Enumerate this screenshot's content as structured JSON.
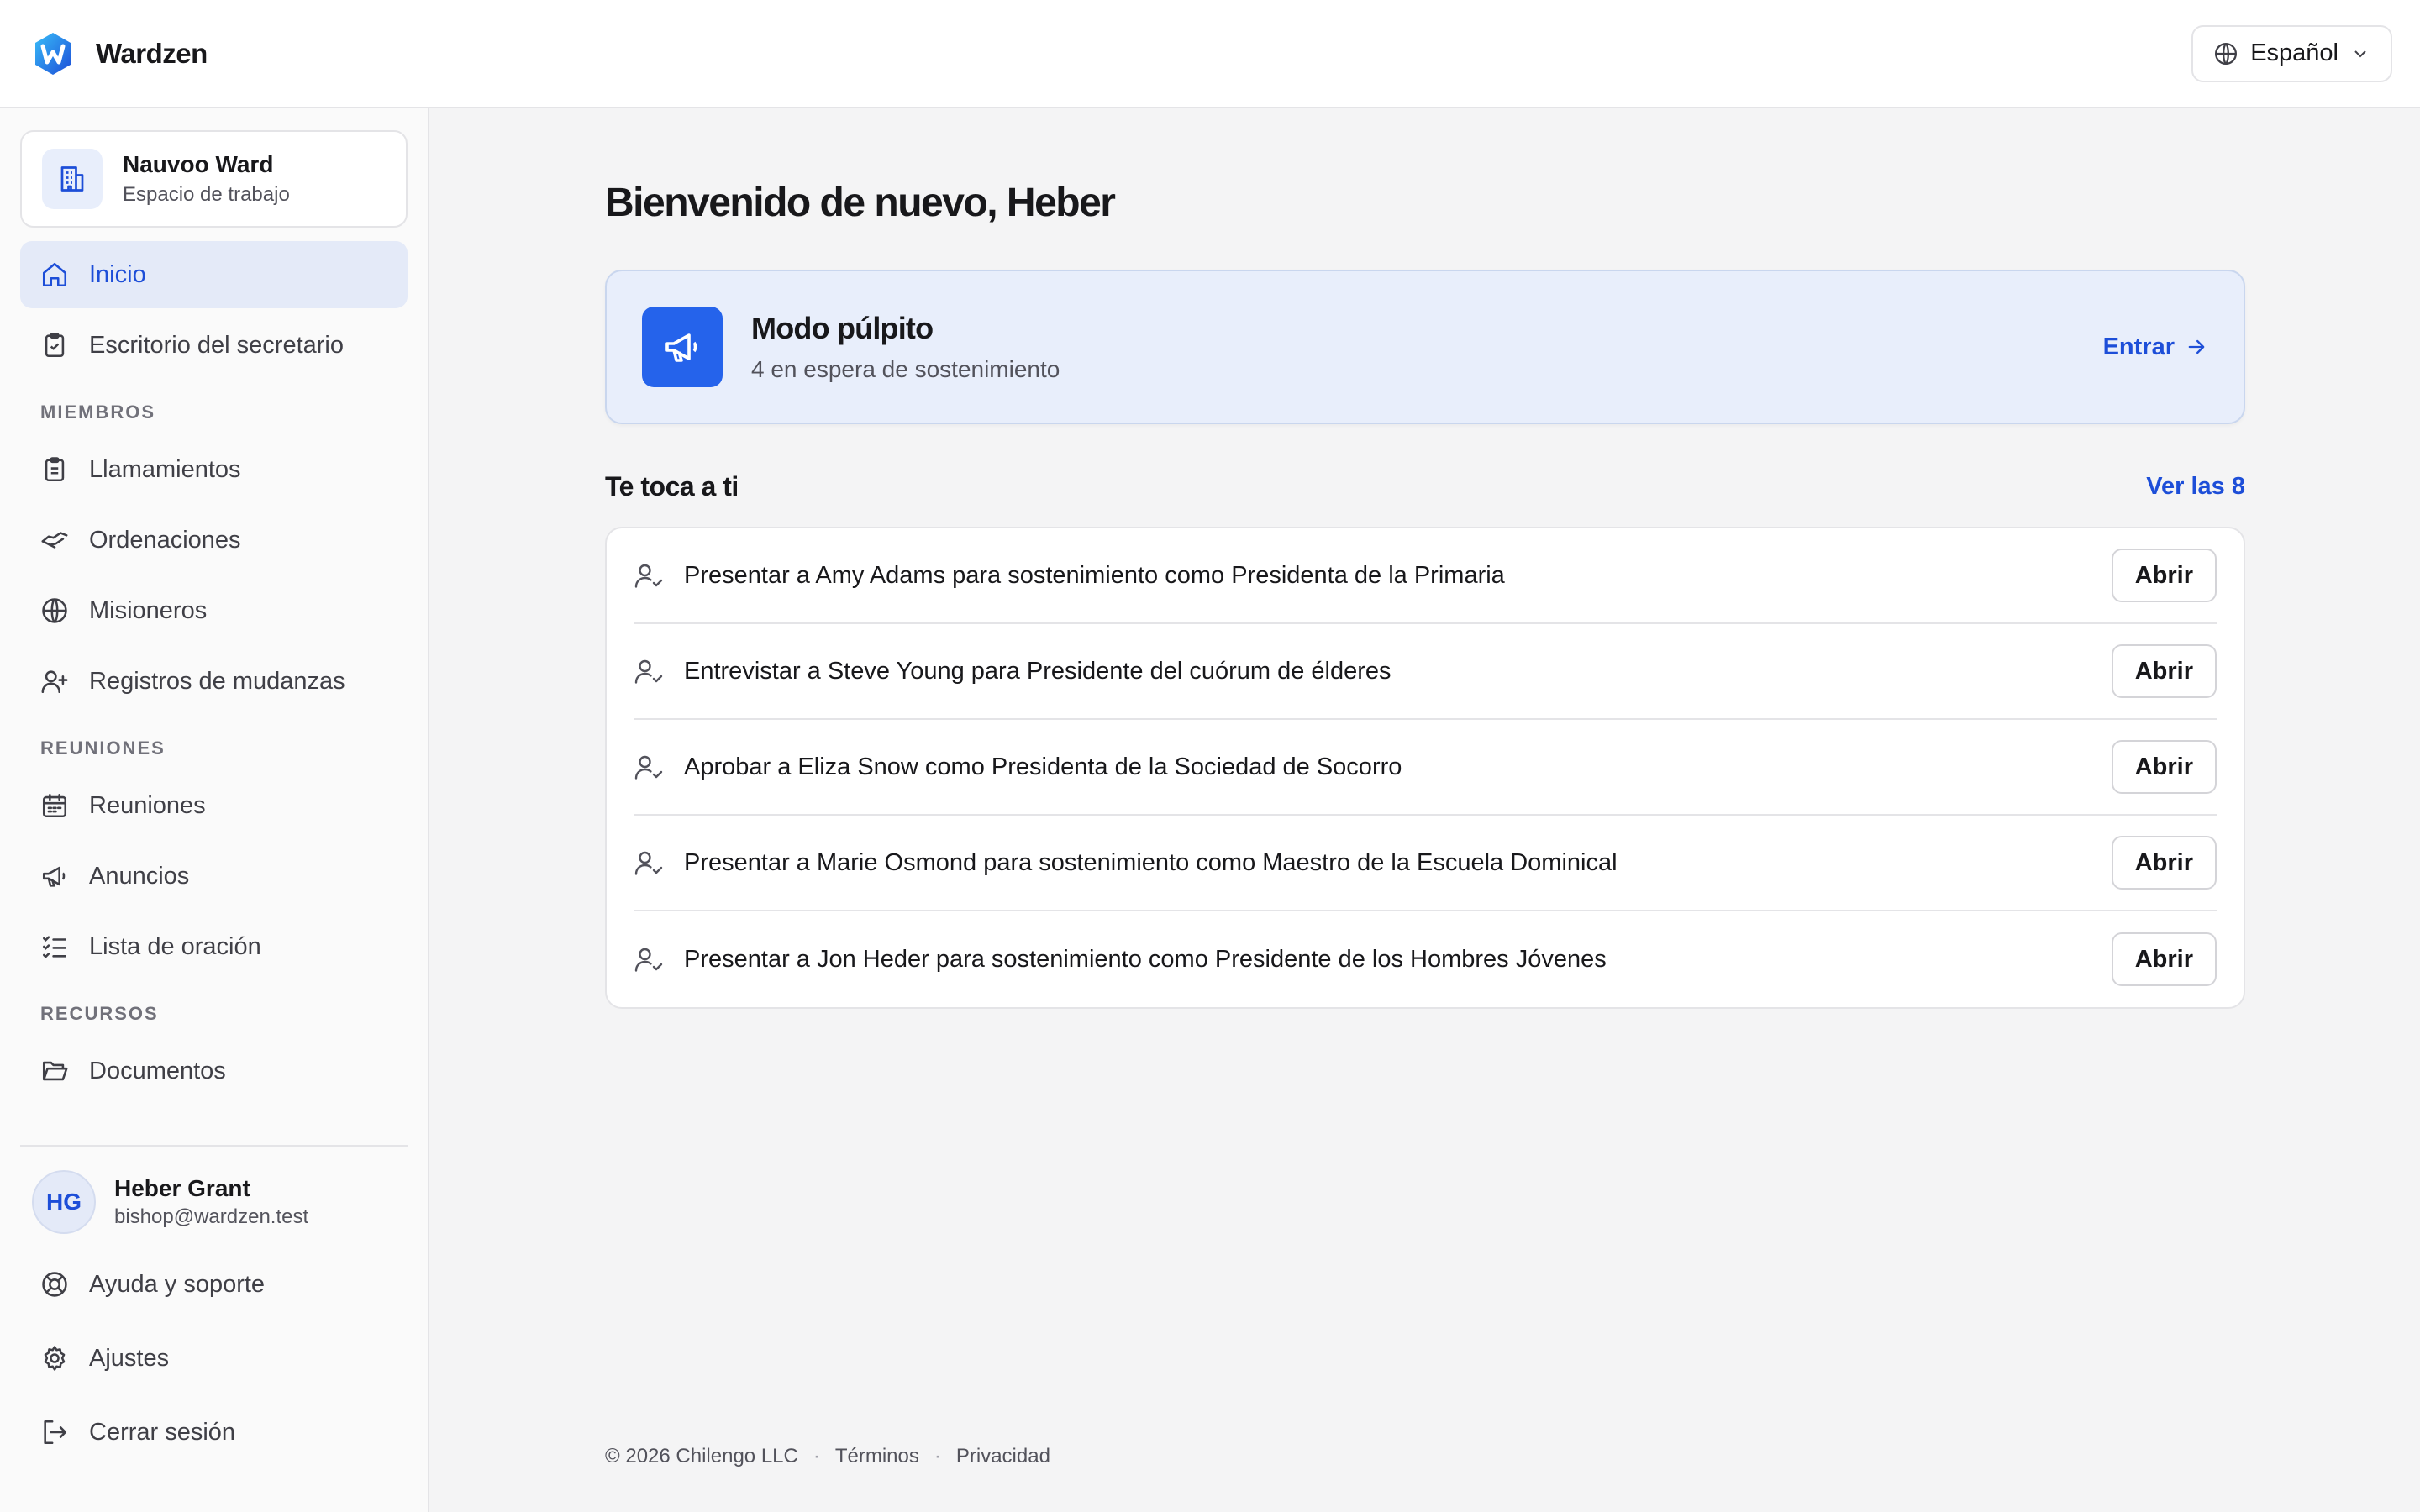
{
  "app": {
    "name": "Wardzen"
  },
  "header": {
    "language": "Español"
  },
  "workspace": {
    "name": "Nauvoo Ward",
    "subtitle": "Espacio de trabajo"
  },
  "nav": {
    "home": "Inicio",
    "secretary": "Escritorio del secretario",
    "members_label": "MIEMBROS",
    "callings": "Llamamientos",
    "ordinations": "Ordenaciones",
    "missionaries": "Misioneros",
    "moves": "Registros de mudanzas",
    "meetings_label": "REUNIONES",
    "meetings": "Reuniones",
    "announcements": "Anuncios",
    "prayer_list": "Lista de oración",
    "resources_label": "RECURSOS",
    "documents": "Documentos"
  },
  "user": {
    "initials": "HG",
    "name": "Heber Grant",
    "email": "bishop@wardzen.test"
  },
  "bottom_nav": {
    "help": "Ayuda y soporte",
    "settings": "Ajustes",
    "logout": "Cerrar sesión"
  },
  "main": {
    "title": "Bienvenido de nuevo, Heber",
    "pulpit": {
      "title": "Modo púlpito",
      "subtitle": "4 en espera de sostenimiento",
      "action": "Entrar"
    },
    "todo": {
      "title": "Te toca a ti",
      "see_all": "Ver las 8",
      "open_label": "Abrir",
      "items": [
        "Presentar a Amy Adams para sostenimiento como Presidenta de la Primaria",
        "Entrevistar a Steve Young para Presidente del cuórum de élderes",
        "Aprobar a Eliza Snow como Presidenta de la Sociedad de Socorro",
        "Presentar a Marie Osmond para sostenimiento como Maestro de la Escuela Dominical",
        "Presentar a Jon Heder para sostenimiento como Presidente de los Hombres Jóvenes"
      ]
    }
  },
  "footer": {
    "copyright": "© 2026 Chilengo LLC",
    "terms": "Términos",
    "privacy": "Privacidad"
  },
  "colors": {
    "accent": "#2563eb",
    "accent_text": "#1d4ed8",
    "active_bg": "#e4eaf8"
  }
}
